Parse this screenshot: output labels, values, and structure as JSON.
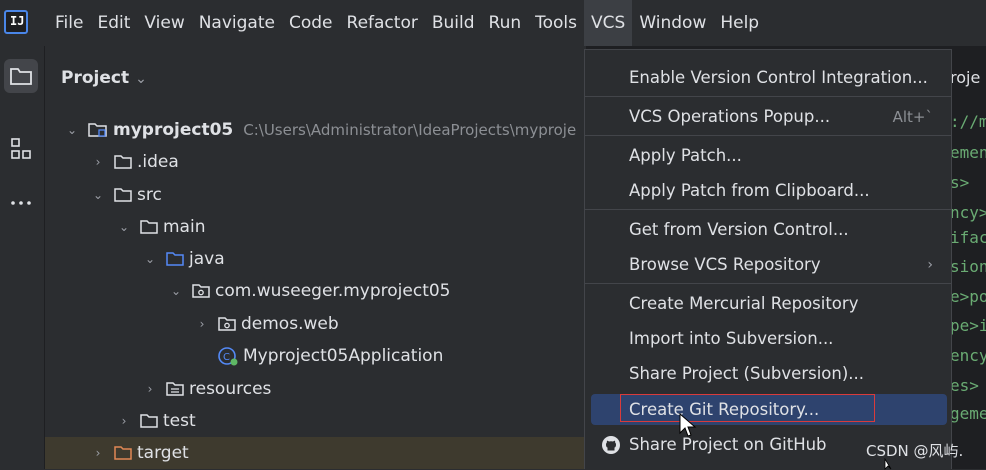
{
  "menubar": {
    "logo_letters": "IJ",
    "items": [
      "File",
      "Edit",
      "View",
      "Navigate",
      "Code",
      "Refactor",
      "Build",
      "Run",
      "Tools",
      "VCS",
      "Window",
      "Help"
    ],
    "active": "VCS"
  },
  "project_panel": {
    "title": "Project",
    "tree": [
      {
        "label": "myproject05",
        "path": "C:\\Users\\Administrator\\IdeaProjects\\myproje",
        "icon": "module-folder-icon"
      },
      {
        "label": ".idea",
        "icon": "folder-icon"
      },
      {
        "label": "src",
        "icon": "folder-icon"
      },
      {
        "label": "main",
        "icon": "folder-icon"
      },
      {
        "label": "java",
        "icon": "source-folder-icon"
      },
      {
        "label": "com.wuseeger.myproject05",
        "icon": "package-icon"
      },
      {
        "label": "demos.web",
        "icon": "package-icon"
      },
      {
        "label": "Myproject05Application",
        "icon": "spring-class-icon"
      },
      {
        "label": "resources",
        "icon": "resources-folder-icon"
      },
      {
        "label": "test",
        "icon": "folder-icon"
      },
      {
        "label": "target",
        "icon": "excluded-folder-icon"
      }
    ]
  },
  "editor": {
    "tab_fragment": "roje",
    "code_fragments": [
      "://m",
      "emen",
      "s>",
      "ncy>",
      "ifac",
      "sion",
      "e>po",
      "pe>i",
      "ency",
      "es>",
      "geme"
    ]
  },
  "vcs_menu": {
    "items": [
      {
        "label": "Enable Version Control Integration...",
        "shortcut": "",
        "submenu": false
      },
      {
        "label": "VCS Operations Popup...",
        "shortcut": "Alt+`",
        "submenu": false
      },
      {
        "label": "Apply Patch...",
        "shortcut": "",
        "submenu": false
      },
      {
        "label": "Apply Patch from Clipboard...",
        "shortcut": "",
        "submenu": false
      },
      {
        "label": "Get from Version Control...",
        "shortcut": "",
        "submenu": false
      },
      {
        "label": "Browse VCS Repository",
        "shortcut": "",
        "submenu": true
      },
      {
        "label": "Create Mercurial Repository",
        "shortcut": "",
        "submenu": false
      },
      {
        "label": "Import into Subversion...",
        "shortcut": "",
        "submenu": false
      },
      {
        "label": "Share Project (Subversion)...",
        "shortcut": "",
        "submenu": false
      },
      {
        "label": "Create Git Repository...",
        "shortcut": "",
        "submenu": false,
        "selected": true
      },
      {
        "label": "Share Project on GitHub",
        "shortcut": "",
        "submenu": false,
        "icon": "github-icon"
      }
    ],
    "submenu_arrow": "›"
  },
  "watermark": "CSDN @风屿.",
  "colors": {
    "background": "#2b2d30",
    "editor_bg": "#1e1f22",
    "selection": "#2e436e",
    "highlight_box": "#d93b3b",
    "folder_blue": "#548af7",
    "excluded_orange": "#e08855",
    "code_green": "#6aab73"
  }
}
